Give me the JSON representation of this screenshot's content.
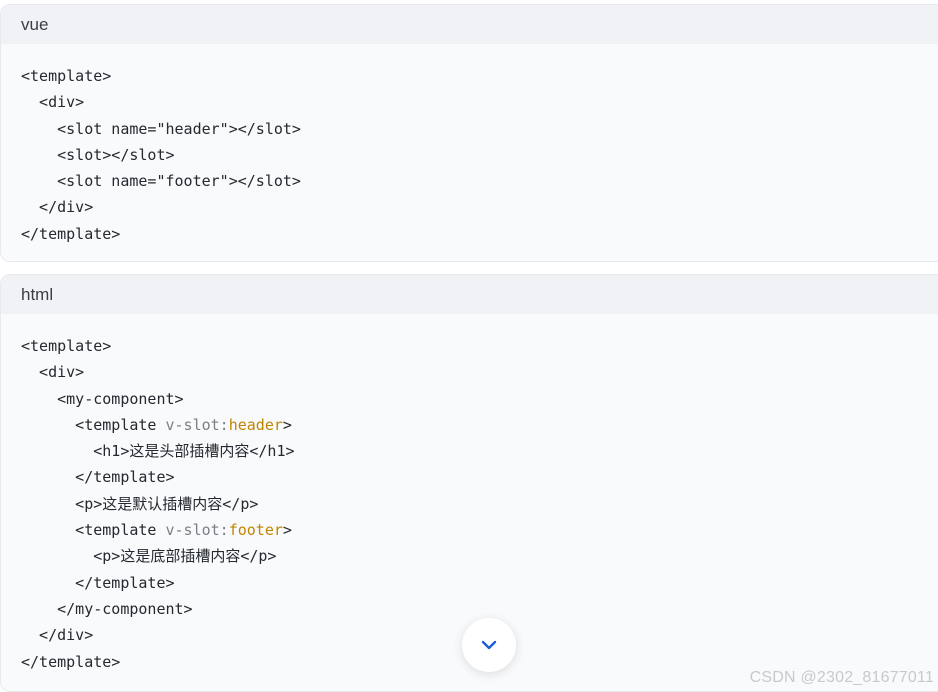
{
  "blocks": [
    {
      "language": "vue",
      "lines": [
        [
          {
            "t": "<template>"
          }
        ],
        [
          {
            "t": "  <div>"
          }
        ],
        [
          {
            "t": "    <slot name=\"header\"></slot>"
          }
        ],
        [
          {
            "t": "    <slot></slot>"
          }
        ],
        [
          {
            "t": "    <slot name=\"footer\"></slot>"
          }
        ],
        [
          {
            "t": "  </div>"
          }
        ],
        [
          {
            "t": "</template>"
          }
        ]
      ]
    },
    {
      "language": "html",
      "lines": [
        [
          {
            "t": "<template>"
          }
        ],
        [
          {
            "t": "  <div>"
          }
        ],
        [
          {
            "t": "    <my-component>"
          }
        ],
        [
          {
            "t": "      <template "
          },
          {
            "t": "v-slot:",
            "c": "attr"
          },
          {
            "t": "header",
            "c": "val"
          },
          {
            "t": ">"
          }
        ],
        [
          {
            "t": "        <h1>这是头部插槽内容</h1>"
          }
        ],
        [
          {
            "t": "      </template>"
          }
        ],
        [
          {
            "t": "      <p>这是默认插槽内容</p>"
          }
        ],
        [
          {
            "t": "      <template "
          },
          {
            "t": "v-slot:",
            "c": "attr"
          },
          {
            "t": "footer",
            "c": "val"
          },
          {
            "t": ">"
          }
        ],
        [
          {
            "t": "        <p>这是底部插槽内容</p>"
          }
        ],
        [
          {
            "t": "      </template>"
          }
        ],
        [
          {
            "t": "    </my-component>"
          }
        ],
        [
          {
            "t": "  </div>"
          }
        ],
        [
          {
            "t": "</template>"
          }
        ]
      ]
    }
  ],
  "expand_button": {
    "icon": "chevron-down-icon",
    "color": "#1a5fd6"
  },
  "watermark": "CSDN @2302_81677011"
}
